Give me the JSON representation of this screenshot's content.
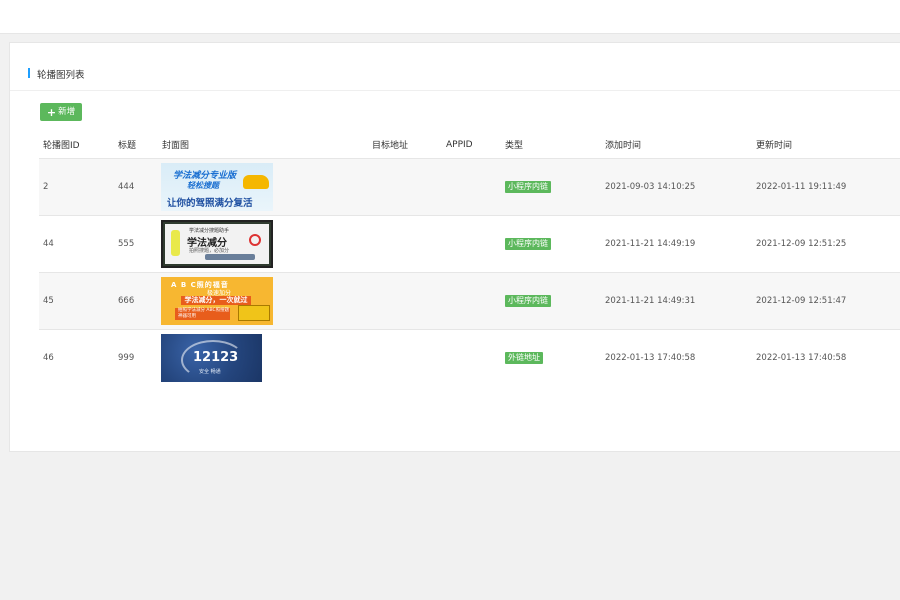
{
  "page": {
    "title": "轮播图列表",
    "add_button": "新增"
  },
  "table": {
    "headers": [
      "轮播图ID",
      "标题",
      "封面图",
      "目标地址",
      "APPID",
      "类型",
      "添加时间",
      "更新时间"
    ],
    "rows": [
      {
        "id": "2",
        "title": "444",
        "url": "",
        "appid": "",
        "type": "小程序内链",
        "created": "2021-09-03 14:10:25",
        "updated": "2022-01-11 19:11:49",
        "cover": {
          "line1": "学法减分专业版",
          "line2": "轻松搜题",
          "line3": "让你的驾照满分复活"
        }
      },
      {
        "id": "44",
        "title": "555",
        "url": "",
        "appid": "",
        "type": "小程序内链",
        "created": "2021-11-21 14:49:19",
        "updated": "2021-12-09 12:51:25",
        "cover": {
          "line1": "学法减分搜题助手",
          "line2": "学法减分",
          "line3": "拍照搜题，必加分"
        }
      },
      {
        "id": "45",
        "title": "666",
        "url": "",
        "appid": "",
        "type": "小程序内链",
        "created": "2021-11-21 14:49:31",
        "updated": "2021-12-09 12:51:47",
        "cover": {
          "line1": "A B C照的福音",
          "line2": "极速加分",
          "line3": "学法减分，一次就过",
          "line4": "拍照学法减分 ABC照搜题神器可用"
        }
      },
      {
        "id": "46",
        "title": "999",
        "url": "",
        "appid": "",
        "type": "外链地址",
        "created": "2022-01-13 17:40:58",
        "updated": "2022-01-13 17:40:58",
        "cover": {
          "line1": "12123",
          "line2": "安全 畅通"
        }
      }
    ]
  },
  "colors": {
    "accent": "#1e9fff",
    "tag_green": "#5cb85c"
  }
}
